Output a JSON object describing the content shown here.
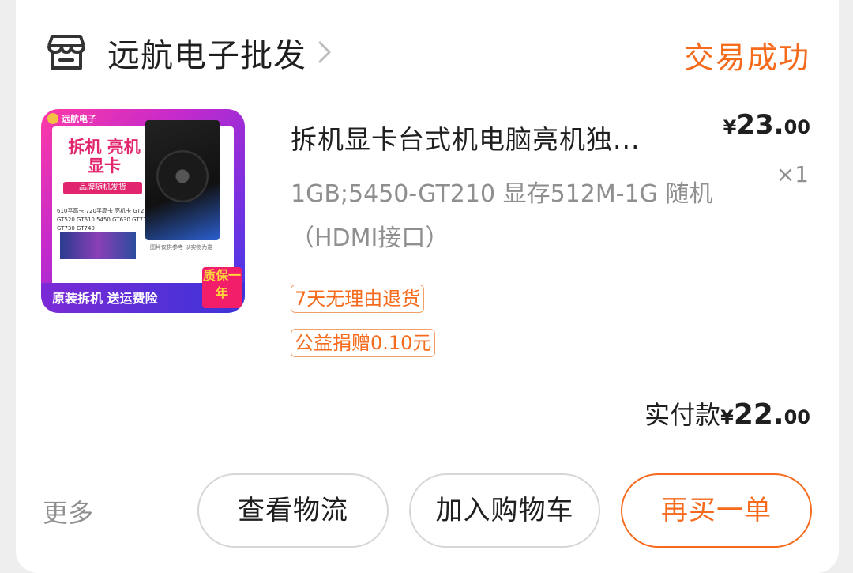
{
  "shop": {
    "name": "远航电子批发",
    "icon": "storefront-icon",
    "chevron": "chevron-right-icon"
  },
  "order": {
    "status": "交易成功"
  },
  "product": {
    "title": "拆机显卡台式机电脑亮机独...",
    "sku": "1GB;5450-GT210 显存512M-1G 随机（HDMI接口）",
    "price_symbol": "¥",
    "price_int": "23.",
    "price_dec": "00",
    "quantity": "×1",
    "tags": [
      "7天无理由退货",
      "公益捐赠0.10元"
    ],
    "thumbnail": {
      "brand": "远航电子",
      "headline": "拆机 亮机显卡",
      "ribbon": "品牌随机发货",
      "models": "610平高卡 720平高卡 亮机卡 GT210 GT520 GT610 5450 GT630 GT710 GT730 GT740",
      "note": "图片仅供参考 以实物为准",
      "sub": "无水洗 无维修",
      "bottom": "原装拆机 送运费险",
      "badge": "质保一年"
    }
  },
  "payment": {
    "label": "实付款",
    "symbol": "¥",
    "int": "22.",
    "dec": "00"
  },
  "actions": {
    "more": "更多",
    "logistics": "查看物流",
    "add_cart": "加入购物车",
    "buy_again": "再买一单"
  },
  "colors": {
    "accent": "#f56a1b",
    "text": "#1f1f1f",
    "muted": "#8f8f8f"
  }
}
